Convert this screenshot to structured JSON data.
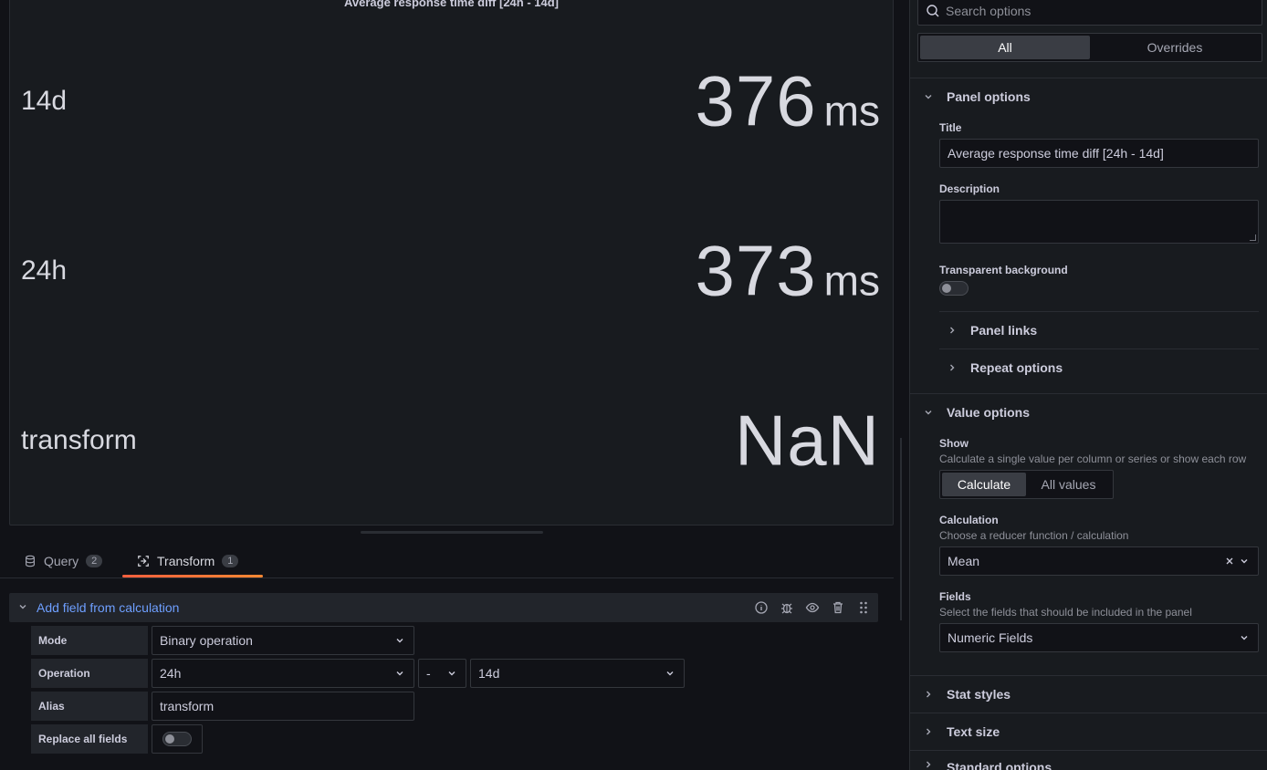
{
  "panel": {
    "title": "Average response time diff [24h - 14d]",
    "stats": [
      {
        "name": "14d",
        "value": "376",
        "unit": "ms"
      },
      {
        "name": "24h",
        "value": "373",
        "unit": "ms"
      },
      {
        "name": "transform",
        "value": "NaN",
        "unit": ""
      }
    ]
  },
  "tabs": [
    {
      "label": "Query",
      "count": "2"
    },
    {
      "label": "Transform",
      "count": "1"
    }
  ],
  "transform": {
    "title": "Add field from calculation",
    "mode_label": "Mode",
    "mode_value": "Binary operation",
    "operation_label": "Operation",
    "operation_left": "24h",
    "operation_operator": "-",
    "operation_right": "14d",
    "alias_label": "Alias",
    "alias_value": "transform",
    "replace_label": "Replace all fields"
  },
  "options": {
    "search_placeholder": "Search options",
    "tab_all": "All",
    "tab_overrides": "Overrides",
    "panel_options": {
      "header": "Panel options",
      "title_label": "Title",
      "title_value": "Average response time diff [24h - 14d]",
      "description_label": "Description",
      "transparent_label": "Transparent background",
      "panel_links": "Panel links",
      "repeat_options": "Repeat options"
    },
    "value_options": {
      "header": "Value options",
      "show_label": "Show",
      "show_desc": "Calculate a single value per column or series or show each row",
      "show_calculate": "Calculate",
      "show_all_values": "All values",
      "calculation_label": "Calculation",
      "calculation_desc": "Choose a reducer function / calculation",
      "calculation_value": "Mean",
      "fields_label": "Fields",
      "fields_desc": "Select the fields that should be included in the panel",
      "fields_value": "Numeric Fields"
    },
    "stat_styles": "Stat styles",
    "text_size": "Text size",
    "standard_options": "Standard options"
  },
  "colors": {
    "accent_link": "#6e9fff",
    "tab_underline": "#ff7733"
  }
}
